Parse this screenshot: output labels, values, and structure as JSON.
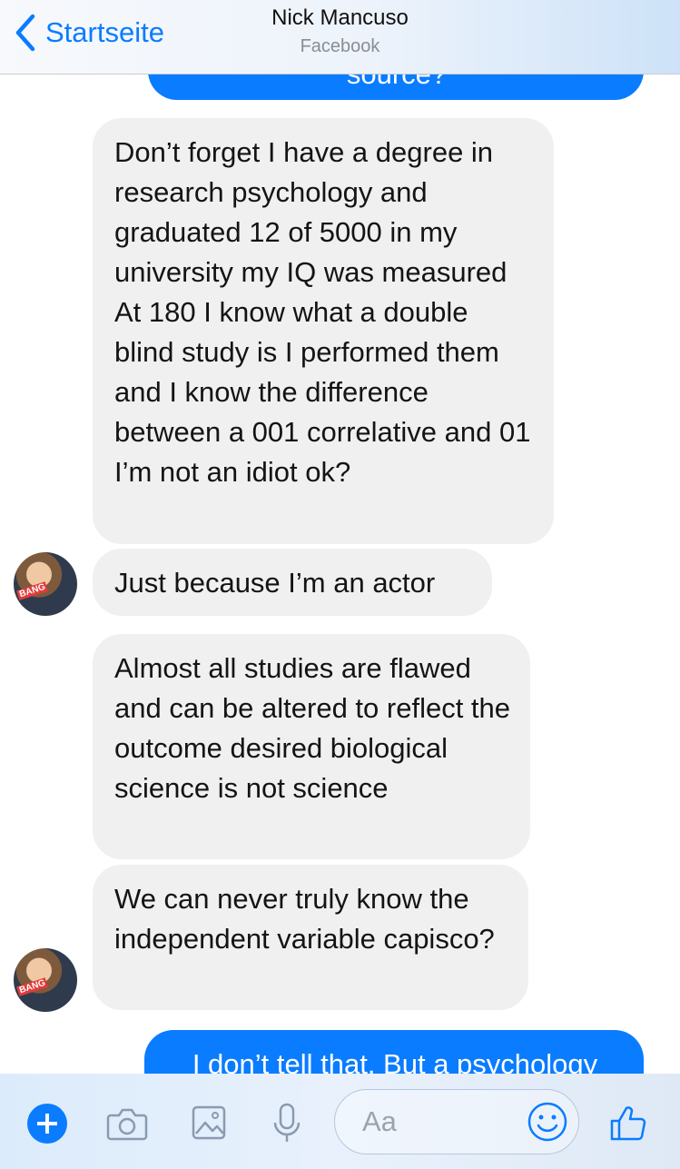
{
  "header": {
    "back_label": "Startseite",
    "contact_name": "Nick Mancuso",
    "subtitle": "Facebook"
  },
  "messages": [
    {
      "sender": "sent",
      "text": "source?"
    },
    {
      "sender": "contact",
      "text": "Don’t forget I have a degree in research psychology and graduated 12 of 5000 in my university my IQ was measured At 180 I know what a double blind study is I performed them and I know the difference between a 001 correlative and 01 I’m not an idiot ok?"
    },
    {
      "sender": "contact",
      "text": "Just because I’m an actor"
    },
    {
      "sender": "contact",
      "text": "Almost all studies are flawed and can be altered to reflect the outcome desired biological science is not science"
    },
    {
      "sender": "contact",
      "text": "We can never truly know the independent variable capisco?"
    },
    {
      "sender": "sent",
      "text": "I don’t tell that. But a psychology"
    }
  ],
  "avatar_tag": "BANG",
  "composer": {
    "placeholder": "Aa",
    "icons": [
      "plus-icon",
      "camera-icon",
      "gallery-icon",
      "microphone-icon",
      "emoji-icon",
      "like-icon"
    ]
  },
  "colors": {
    "accent": "#0a7cff",
    "received_bubble": "#f0f0f0"
  }
}
